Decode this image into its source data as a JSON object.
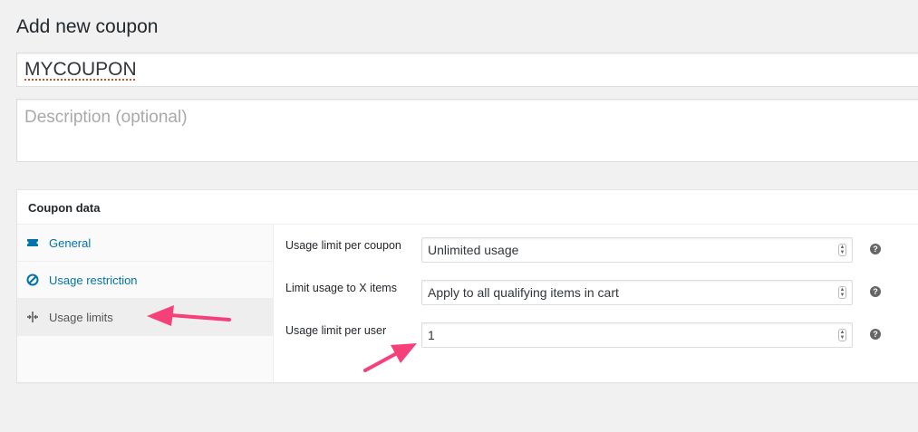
{
  "page": {
    "title": "Add new coupon"
  },
  "coupon": {
    "code": "MYCOUPON",
    "description_placeholder": "Description (optional)"
  },
  "panel": {
    "title": "Coupon data",
    "tabs": [
      {
        "label": "General",
        "icon": "ticket-icon"
      },
      {
        "label": "Usage restriction",
        "icon": "ban-icon"
      },
      {
        "label": "Usage limits",
        "icon": "usage-limits-icon"
      }
    ],
    "fields": [
      {
        "label": "Usage limit per coupon",
        "value": "Unlimited usage"
      },
      {
        "label": "Limit usage to X items",
        "value": "Apply to all qualifying items in cart"
      },
      {
        "label": "Usage limit per user",
        "value": "1"
      }
    ],
    "help_glyph": "?"
  },
  "colors": {
    "link": "#0073aa",
    "annotation_arrow": "#f5407a"
  }
}
